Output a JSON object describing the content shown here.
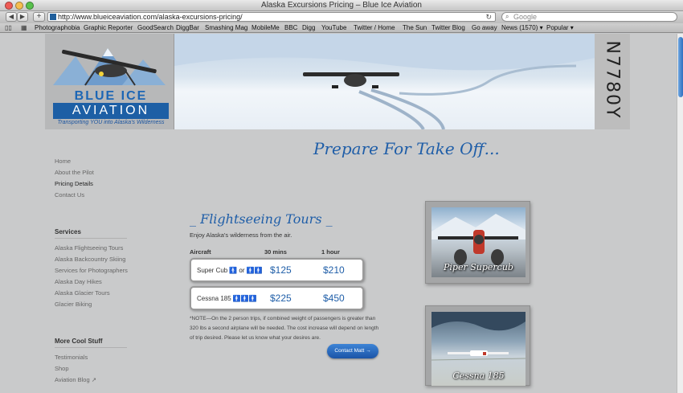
{
  "browser": {
    "window_title": "Alaska Excursions Pricing – Blue Ice Aviation",
    "url": "http://www.blueiceaviation.com/alaska-excursions-pricing/",
    "search_placeholder": "Google",
    "back_icon": "◀",
    "forward_icon": "▶",
    "add_icon": "+",
    "reload_icon": "↻",
    "search_icon": "⌕",
    "bookmarks": [
      "Photographobia",
      "Graphic Reporter",
      "GoodSearch",
      "DiggBar",
      "Smashing Mag",
      "MobileMe",
      "BBC",
      "Digg",
      "YouTube",
      "Twitter / Home",
      "The Sun",
      "Twitter Blog",
      "Go away",
      "News (1570) ▾",
      "Popular ▾"
    ]
  },
  "banner": {
    "logo_line1": "BLUE ICE",
    "logo_line2": "AVIATION",
    "tagline": "Transporting YOU into Alaska's Wilderness",
    "tail_number": "N7780Y"
  },
  "main": {
    "headline": "Prepare For Take Off...",
    "section_title": "_ Flightseeing Tours _",
    "intro": "Enjoy Alaska's wilderness from the air.",
    "table_headers": [
      "Aircraft",
      "30 mins",
      "1 hour"
    ],
    "rows": [
      {
        "aircraft": "Super Cub",
        "pax": "🚹 or 🚹🚹",
        "price_30": "$125",
        "price_60": "$210"
      },
      {
        "aircraft": "Cessna 185",
        "pax": "🚹🚹🚹",
        "price_30": "$225",
        "price_60": "$450"
      }
    ],
    "note": "*NOTE—On the 2 person trips, if combined weight of passengers is greater than 320 lbs a second airplane will be needed. The cost increase will depend on length of trip desired. Please let us know what your desires are.",
    "contact_button": "Contact Matt →"
  },
  "sidebar": {
    "nav": [
      "Home",
      "About the Pilot",
      "Pricing Details",
      "Contact Us"
    ],
    "services_heading": "Services",
    "services": [
      "Alaska Flightseeing Tours",
      "Alaska Backcountry Skiing",
      "Services for Photographers",
      "Alaska Day Hikes",
      "Alaska Glacier Tours",
      "Glacier Biking"
    ],
    "more_heading": "More Cool Stuff",
    "more": [
      "Testimonials",
      "Shop",
      "Aviation Blog ↗"
    ]
  },
  "gallery": {
    "cards": [
      "Piper Supercub",
      "Cessna 185"
    ]
  }
}
